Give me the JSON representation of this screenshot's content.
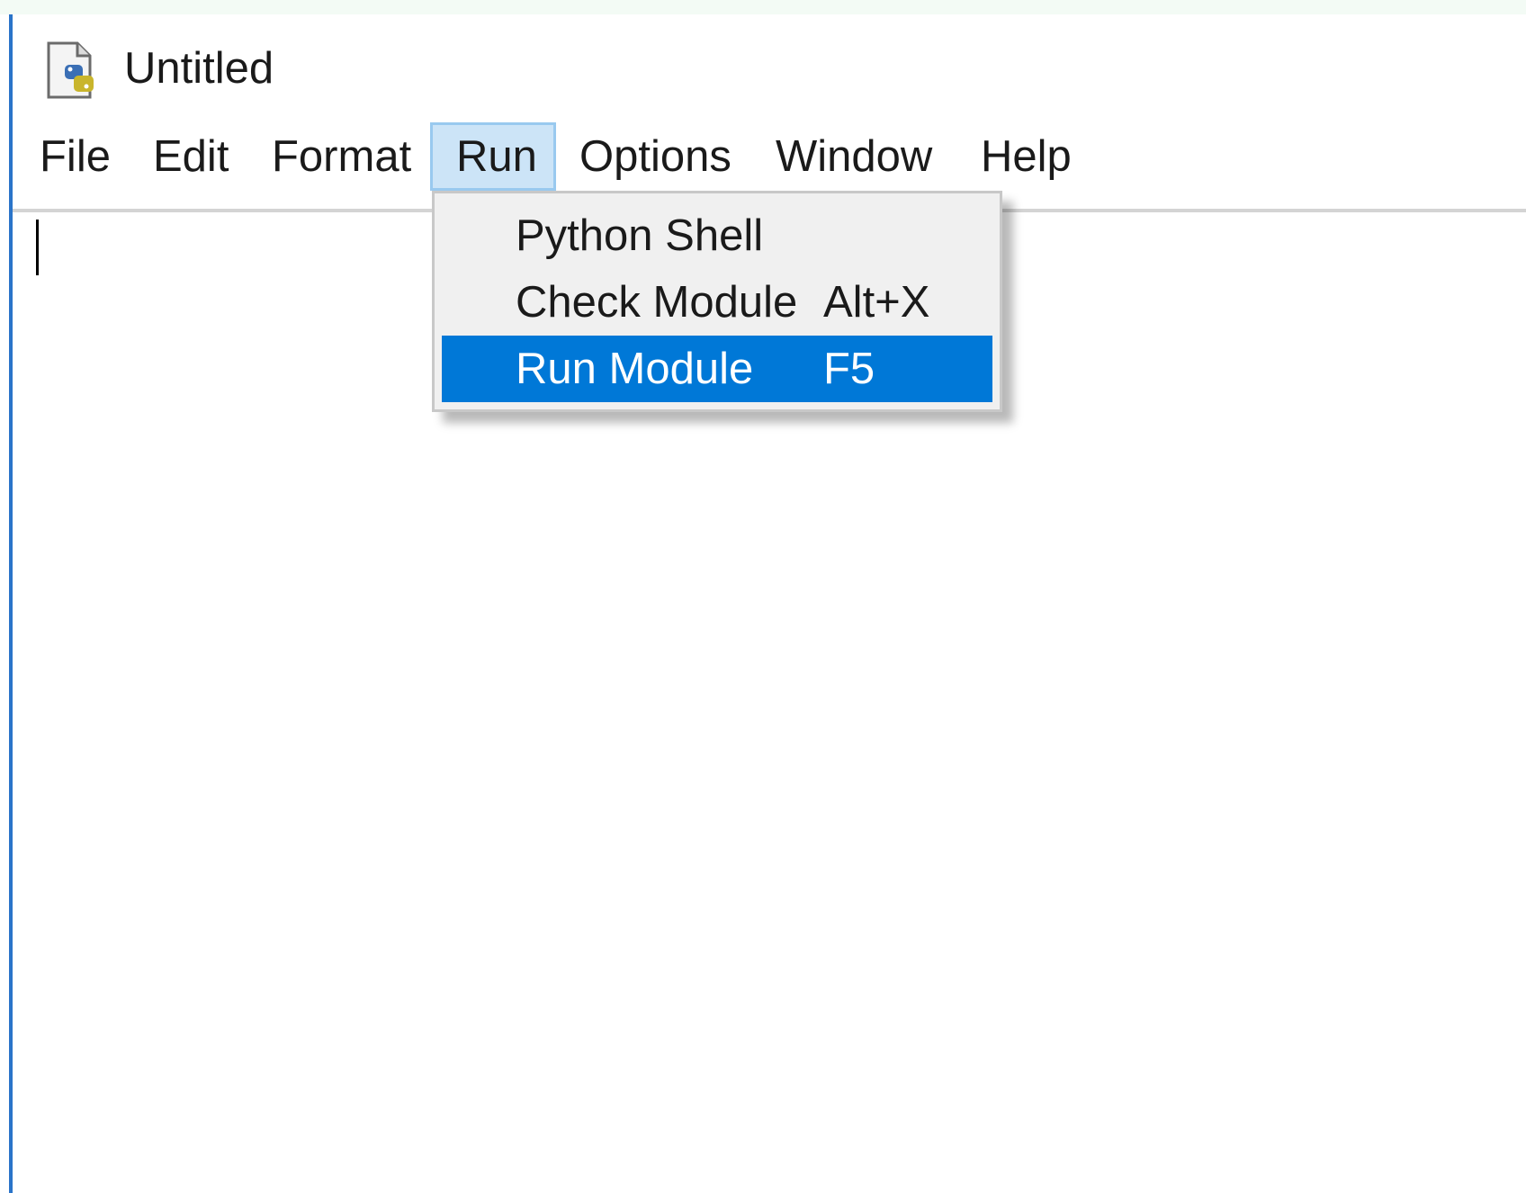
{
  "window": {
    "title": "Untitled"
  },
  "menubar": {
    "items": [
      {
        "label": "File"
      },
      {
        "label": "Edit"
      },
      {
        "label": "Format"
      },
      {
        "label": "Run"
      },
      {
        "label": "Options"
      },
      {
        "label": "Window"
      },
      {
        "label": "Help"
      }
    ],
    "active": "Run"
  },
  "run_menu": {
    "items": [
      {
        "label": "Python Shell",
        "accelerator": ""
      },
      {
        "label": "Check Module",
        "accelerator": "Alt+X"
      },
      {
        "label": "Run Module",
        "accelerator": "F5"
      }
    ],
    "highlighted": "Run Module"
  },
  "icons": {
    "app": "python-file-icon"
  },
  "colors": {
    "window_border": "#2a74c9",
    "menu_active_bg": "#cce4f7",
    "menu_highlight_bg": "#0078d7"
  }
}
